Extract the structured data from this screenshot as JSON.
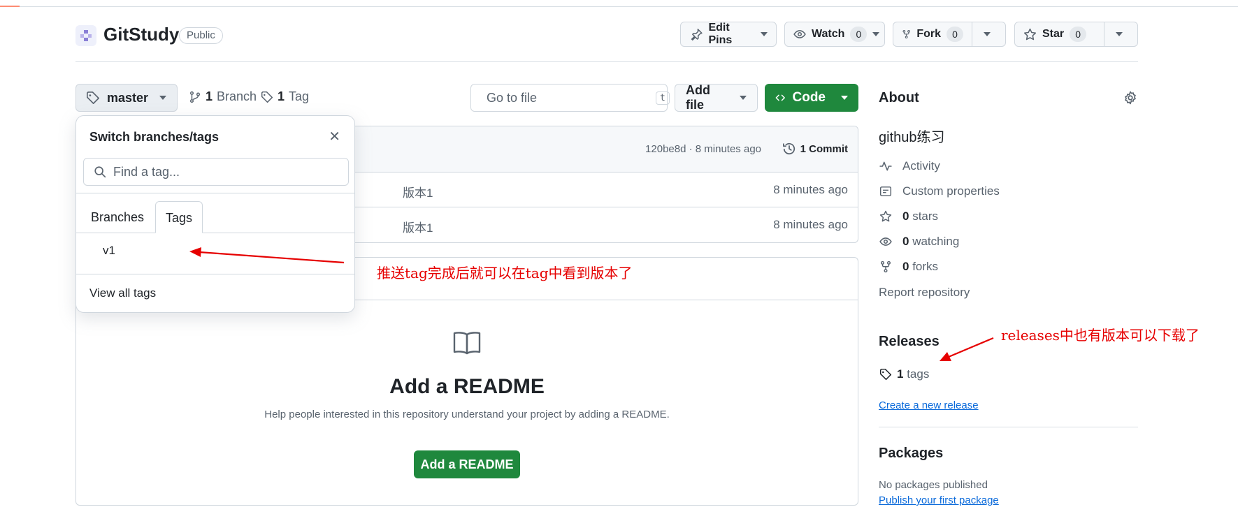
{
  "header": {
    "repo_name": "GitStudy",
    "visibility": "Public",
    "edit_pins_label": "Edit Pins",
    "watch_label": "Watch",
    "watch_count": "0",
    "fork_label": "Fork",
    "fork_count": "0",
    "star_label": "Star",
    "star_count": "0"
  },
  "toolbar": {
    "branch_name": "master",
    "branch_count": "1",
    "branch_label": "Branch",
    "tag_count": "1",
    "tag_label": "Tag",
    "goto_placeholder": "Go to file",
    "goto_shortcut": "t",
    "add_file_label": "Add file",
    "code_label": "Code"
  },
  "commit_bar": {
    "info": "120be8d · 8 minutes ago",
    "commit_count": "1 Commit"
  },
  "files": [
    {
      "message": "版本1",
      "age": "8 minutes ago"
    },
    {
      "message": "版本1",
      "age": "8 minutes ago"
    }
  ],
  "readme": {
    "title": "Add a README",
    "description": "Help people interested in this repository understand your project by adding a README.",
    "button_label": "Add a README"
  },
  "dropdown": {
    "title": "Switch branches/tags",
    "search_placeholder": "Find a tag...",
    "tabs": [
      "Branches",
      "Tags"
    ],
    "active_tab": "Tags",
    "items": [
      "v1"
    ],
    "view_all": "View all tags"
  },
  "sidebar": {
    "about_title": "About",
    "description": "github练习",
    "activity": "Activity",
    "custom_properties": "Custom properties",
    "stars_count": "0",
    "stars_label": "stars",
    "watching_count": "0",
    "watching_label": "watching",
    "forks_count": "0",
    "forks_label": "forks",
    "report": "Report repository",
    "releases_title": "Releases",
    "releases_tag_count": "1",
    "releases_tag_label": "tags",
    "create_release": "Create a new release",
    "packages_title": "Packages",
    "packages_none": "No packages published",
    "publish_package": "Publish your first package"
  },
  "annotations": {
    "tag_note": "推送tag完成后就可以在tag中看到版本了",
    "release_note": "releases中也有版本可以下载了"
  },
  "colors": {
    "primary_green": "#1f883d",
    "link_blue": "#0969da",
    "annotation_red": "#e60000"
  }
}
